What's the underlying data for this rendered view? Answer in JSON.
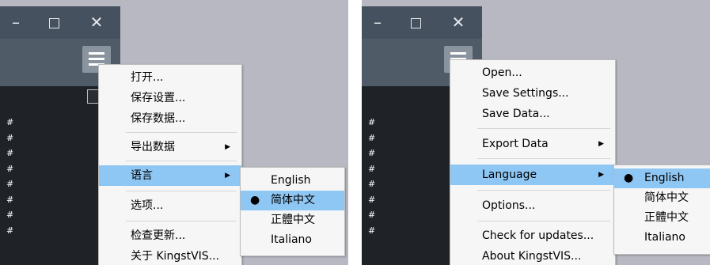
{
  "window": {
    "minimize": "–",
    "close": "✕"
  },
  "left": {
    "menu": [
      {
        "label": "打开..."
      },
      {
        "label": "保存设置..."
      },
      {
        "label": "保存数据..."
      },
      {
        "label": "导出数据"
      },
      {
        "label": "语言"
      },
      {
        "label": "选项..."
      },
      {
        "label": "检查更新..."
      },
      {
        "label": "关于 KingstVIS..."
      }
    ],
    "submenu": [
      {
        "label": "English"
      },
      {
        "label": "简体中文"
      },
      {
        "label": "正體中文"
      },
      {
        "label": "Italiano"
      }
    ]
  },
  "right": {
    "menu": [
      {
        "label": "Open..."
      },
      {
        "label": "Save Settings..."
      },
      {
        "label": "Save Data..."
      },
      {
        "label": "Export Data"
      },
      {
        "label": "Language"
      },
      {
        "label": "Options..."
      },
      {
        "label": "Check for updates..."
      },
      {
        "label": "About KingstVIS..."
      }
    ],
    "submenu": [
      {
        "label": "English"
      },
      {
        "label": "简体中文"
      },
      {
        "label": "正體中文"
      },
      {
        "label": "Italiano"
      }
    ]
  },
  "symbols": {
    "arrow": "▶",
    "dot": "●",
    "hash": "#"
  },
  "colors": {
    "highlight": "#8ec6f4",
    "titlebar": "#46515f",
    "toolbar": "#505b68",
    "console": "#1f2226",
    "background": "#b8b8c2"
  }
}
